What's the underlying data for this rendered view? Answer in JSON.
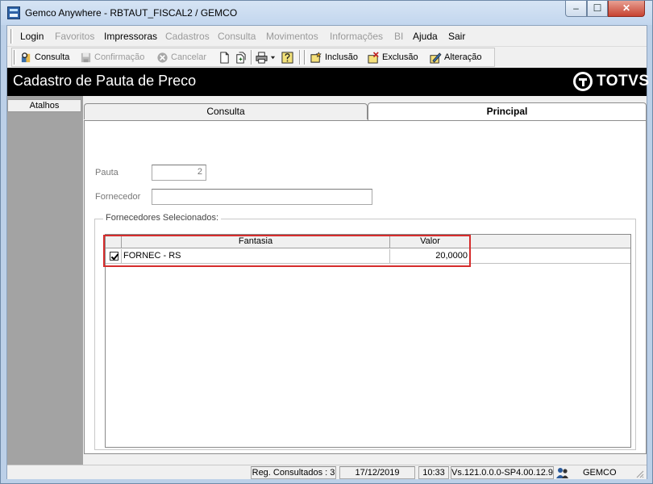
{
  "window": {
    "title": "Gemco Anywhere - RBTAUT_FISCAL2 / GEMCO",
    "controls": {
      "minimize": "–",
      "maximize": "☐",
      "close": "✕"
    }
  },
  "menu": {
    "items": [
      {
        "label": "Login",
        "enabled": true
      },
      {
        "label": "Favoritos",
        "enabled": false
      },
      {
        "label": "Impressoras",
        "enabled": true
      },
      {
        "label": "Cadastros",
        "enabled": false
      },
      {
        "label": "Consulta",
        "enabled": false
      },
      {
        "label": "Movimentos",
        "enabled": false
      },
      {
        "label": "Informações",
        "enabled": false
      },
      {
        "label": "BI",
        "enabled": false
      },
      {
        "label": "Ajuda",
        "enabled": true
      },
      {
        "label": "Sair",
        "enabled": true
      }
    ]
  },
  "toolbar": {
    "consulta": "Consulta",
    "confirmacao": "Confirmação",
    "cancelar": "Cancelar",
    "inclusao": "Inclusão",
    "exclusao": "Exclusão",
    "alteracao": "Alteração",
    "icons": [
      "search-icon",
      "save-icon",
      "cancel-icon",
      "new-document-icon",
      "open-document-icon",
      "printer-icon",
      "help-icon",
      "add-icon",
      "delete-icon",
      "edit-icon"
    ]
  },
  "header": {
    "title": "Cadastro de Pauta de Preco",
    "brand": "TOTVS"
  },
  "sidebar": {
    "tab_label": "Atalhos"
  },
  "tabs": [
    {
      "label": "Consulta",
      "active": false
    },
    {
      "label": "Principal",
      "active": true
    }
  ],
  "form": {
    "pauta_label": "Pauta",
    "pauta_value": "2",
    "fornecedor_label": "Fornecedor",
    "fornecedor_value": "",
    "group_title": "Fornecedores Selecionados:",
    "grid": {
      "columns": [
        "Fantasia",
        "Valor"
      ],
      "rows": [
        {
          "checked": true,
          "fantasia": "FORNEC - RS",
          "valor": "20,0000"
        }
      ]
    }
  },
  "status": {
    "reg_consultados": "Reg. Consultados : 3",
    "date": "17/12/2019",
    "time": "10:33",
    "version": "Vs.121.0.0.0-SP4.00.12.9",
    "user": "GEMCO"
  },
  "colors": {
    "highlight": "#d62c2c",
    "header_band": "#000000"
  }
}
